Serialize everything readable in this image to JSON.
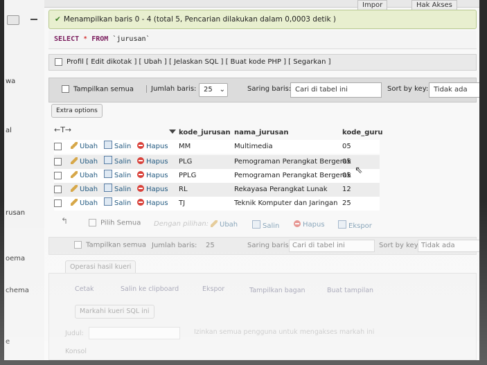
{
  "tabs": [
    "Impor",
    "Hak Akses"
  ],
  "sidebar": [
    "wa",
    "al",
    "rusan",
    "oema",
    "chema",
    "e"
  ],
  "success_message": "Menampilkan baris 0 - 4 (total 5, Pencarian dilakukan dalam 0,0003 detik )",
  "sql": {
    "select": "SELECT",
    "star": "*",
    "from": "FROM",
    "table": "`jurusan`"
  },
  "profil_links": "Profil [ Edit dikotak ] [ Ubah ] [ Jelaskan SQL ] [ Buat kode PHP ] [ Segarkan ]",
  "filter": {
    "show_all": "Tampilkan semua",
    "rows_label": "Jumlah baris:",
    "rows_value": "25",
    "filter_label": "Saring baris:",
    "filter_placeholder": "Cari di tabel ini",
    "sort_label": "Sort by key:",
    "sort_value": "Tidak ada"
  },
  "extra_options": "Extra options",
  "columns": [
    "kode_jurusan",
    "nama_jurusan",
    "kode_guru"
  ],
  "actions": {
    "edit": "Ubah",
    "copy": "Salin",
    "delete": "Hapus"
  },
  "rows": [
    {
      "kode": "MM",
      "nama": "Multimedia",
      "guru": "05"
    },
    {
      "kode": "PLG",
      "nama": "Pemograman Perangkat Bergerak",
      "guru": "05"
    },
    {
      "kode": "PPLG",
      "nama": "Pemograman Perangkat Bergerak",
      "guru": "05"
    },
    {
      "kode": "RL",
      "nama": "Rekayasa Perangkat Lunak",
      "guru": "12"
    },
    {
      "kode": "TJ",
      "nama": "Teknik Komputer dan Jaringan",
      "guru": "25"
    }
  ],
  "bulk": {
    "select_all": "Pilih Semua",
    "with_selected": "Dengan pilihan:",
    "edit": "Ubah",
    "copy": "Salin",
    "delete": "Hapus",
    "export": "Ekspor"
  },
  "bottom": {
    "ops_title": "Operasi hasil kueri",
    "print": "Cetak",
    "copy_clip": "Salin ke clipboard",
    "export": "Ekspor",
    "chart": "Tampilkan bagan",
    "view": "Buat tampilan",
    "bookmark": "Markahi kueri SQL ini",
    "label": "Judul:",
    "share": "Izinkan semua pengguna untuk mengakses markah ini",
    "console": "Konsol"
  }
}
